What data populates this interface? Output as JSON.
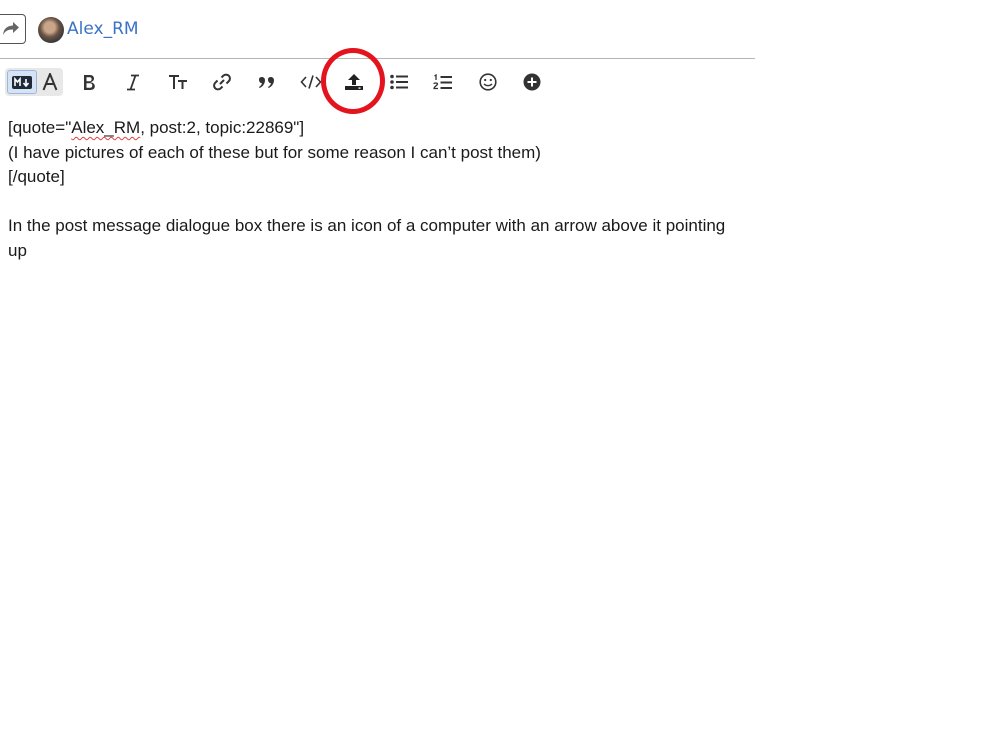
{
  "header": {
    "username": "Alex_RM"
  },
  "toolbar": {
    "buttons": [
      {
        "name": "markdown-mode",
        "icon": "markdown-icon"
      },
      {
        "name": "rich-text-mode",
        "icon": "letter-a-icon"
      },
      {
        "name": "bold",
        "icon": "bold-icon"
      },
      {
        "name": "italic",
        "icon": "italic-icon"
      },
      {
        "name": "heading",
        "icon": "heading-icon"
      },
      {
        "name": "link",
        "icon": "link-icon"
      },
      {
        "name": "blockquote",
        "icon": "quote-icon"
      },
      {
        "name": "code",
        "icon": "code-icon"
      },
      {
        "name": "upload",
        "icon": "upload-icon"
      },
      {
        "name": "bullet-list",
        "icon": "bullet-list-icon"
      },
      {
        "name": "numbered-list",
        "icon": "numbered-list-icon"
      },
      {
        "name": "emoji",
        "icon": "smiley-icon"
      },
      {
        "name": "more-options",
        "icon": "plus-circle-icon"
      }
    ],
    "highlighted": "upload",
    "annotation_color": "#e3141d"
  },
  "editor": {
    "line1_prefix": "[quote=\"",
    "line1_user": "Alex_RM",
    "line1_suffix": ", post:2, topic:22869\"]",
    "line2": "(I have pictures of each of these but for some reason I can’t post them)",
    "line3": "[/quote]",
    "line4": "",
    "line5": "In the post message dialogue box there is an icon of a computer with an arrow above it pointing up"
  },
  "colors": {
    "username": "#3a73c6",
    "spellcheck_underline": "#e34040"
  }
}
